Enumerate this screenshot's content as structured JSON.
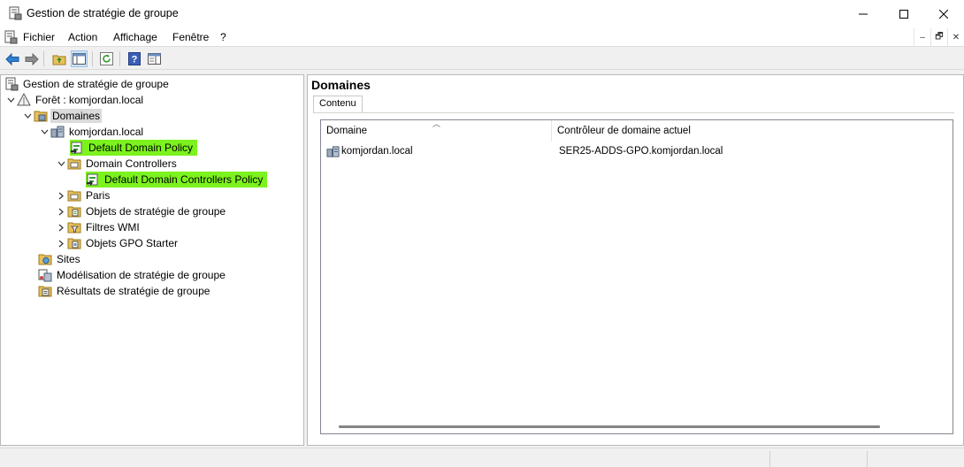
{
  "window": {
    "title": "Gestion de stratégie de groupe",
    "min_symbol": "—",
    "max_symbol": "□",
    "close_symbol": "✕"
  },
  "menubar": {
    "items": [
      "Fichier",
      "Action",
      "Affichage",
      "Fenêtre",
      "?"
    ],
    "mdi": [
      "–",
      "🗗",
      "✕"
    ]
  },
  "toolbar": {
    "buttons": [
      "back-arrow-icon",
      "forward-arrow-icon",
      "up-folder-icon",
      "show-hide-tree-icon",
      "refresh-icon",
      "help-icon",
      "properties-pane-icon"
    ]
  },
  "tree": {
    "items": [
      {
        "label": "Gestion de stratégie de groupe",
        "icon": "gpmc-root-icon"
      },
      {
        "label": "Forêt : komjordan.local",
        "icon": "forest-icon"
      },
      {
        "label": "Domaines",
        "icon": "domains-folder-icon"
      },
      {
        "label": "komjordan.local",
        "icon": "domain-icon"
      },
      {
        "label": "Default Domain Policy",
        "icon": "gpo-link-icon"
      },
      {
        "label": "Domain Controllers",
        "icon": "ou-folder-icon"
      },
      {
        "label": "Default Domain Controllers Policy",
        "icon": "gpo-link-icon"
      },
      {
        "label": "Paris",
        "icon": "ou-folder-icon"
      },
      {
        "label": "Objets de stratégie de groupe",
        "icon": "gpo-folder-icon"
      },
      {
        "label": "Filtres WMI",
        "icon": "wmi-folder-icon"
      },
      {
        "label": "Objets GPO Starter",
        "icon": "starter-gpo-folder-icon"
      },
      {
        "label": "Sites",
        "icon": "sites-folder-icon"
      },
      {
        "label": "Modélisation de stratégie de groupe",
        "icon": "modeling-icon"
      },
      {
        "label": "Résultats de stratégie de groupe",
        "icon": "results-icon"
      }
    ]
  },
  "right_pane": {
    "title": "Domaines",
    "tab": "Contenu",
    "columns": [
      "Domaine",
      "Contrôleur de domaine actuel"
    ],
    "rows": [
      {
        "domain": "komjordan.local",
        "controller": "SER25-ADDS-GPO.komjordan.local"
      }
    ]
  },
  "colors": {
    "highlight": "#7cf21e",
    "selected": "#dadada"
  }
}
